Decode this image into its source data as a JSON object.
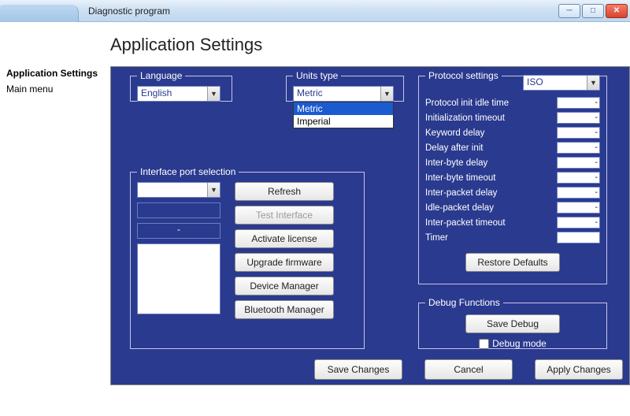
{
  "window": {
    "title": "Diagnostic program"
  },
  "heading": "Application Settings",
  "sidebar": {
    "items": [
      {
        "label": "Application Settings",
        "bold": true
      },
      {
        "label": "Main menu",
        "bold": false
      }
    ]
  },
  "groups": {
    "language": {
      "legend": "Language",
      "value": "English"
    },
    "units": {
      "legend": "Units type",
      "value": "Metric",
      "options": [
        "Metric",
        "Imperial"
      ],
      "selected": "Metric"
    },
    "port": {
      "legend": "Interface port selection",
      "select_value": "",
      "field2": "",
      "field3": "-",
      "buttons": {
        "refresh": "Refresh",
        "test": "Test Interface",
        "activate": "Activate license",
        "upgrade": "Upgrade firmware",
        "device": "Device Manager",
        "bluetooth": "Bluetooth Manager"
      }
    },
    "protocol": {
      "legend": "Protocol settings",
      "value": "ISO",
      "restore": "Restore Defaults",
      "rows": [
        {
          "label": "Protocol init idle time",
          "value": "-"
        },
        {
          "label": "Initialization timeout",
          "value": "-"
        },
        {
          "label": "Keyword delay",
          "value": "-"
        },
        {
          "label": "Delay after init",
          "value": "-"
        },
        {
          "label": "Inter-byte delay",
          "value": "-"
        },
        {
          "label": "Inter-byte timeout",
          "value": "-"
        },
        {
          "label": "Inter-packet delay",
          "value": "-"
        },
        {
          "label": "Idle-packet delay",
          "value": "-"
        },
        {
          "label": "Inter-packet timeout",
          "value": "-"
        },
        {
          "label": "Timer",
          "value": ""
        }
      ]
    },
    "debug": {
      "legend": "Debug Functions",
      "save": "Save Debug",
      "mode_label": "Debug mode"
    }
  },
  "bottom": {
    "save": "Save Changes",
    "cancel": "Cancel",
    "apply": "Apply Changes"
  }
}
